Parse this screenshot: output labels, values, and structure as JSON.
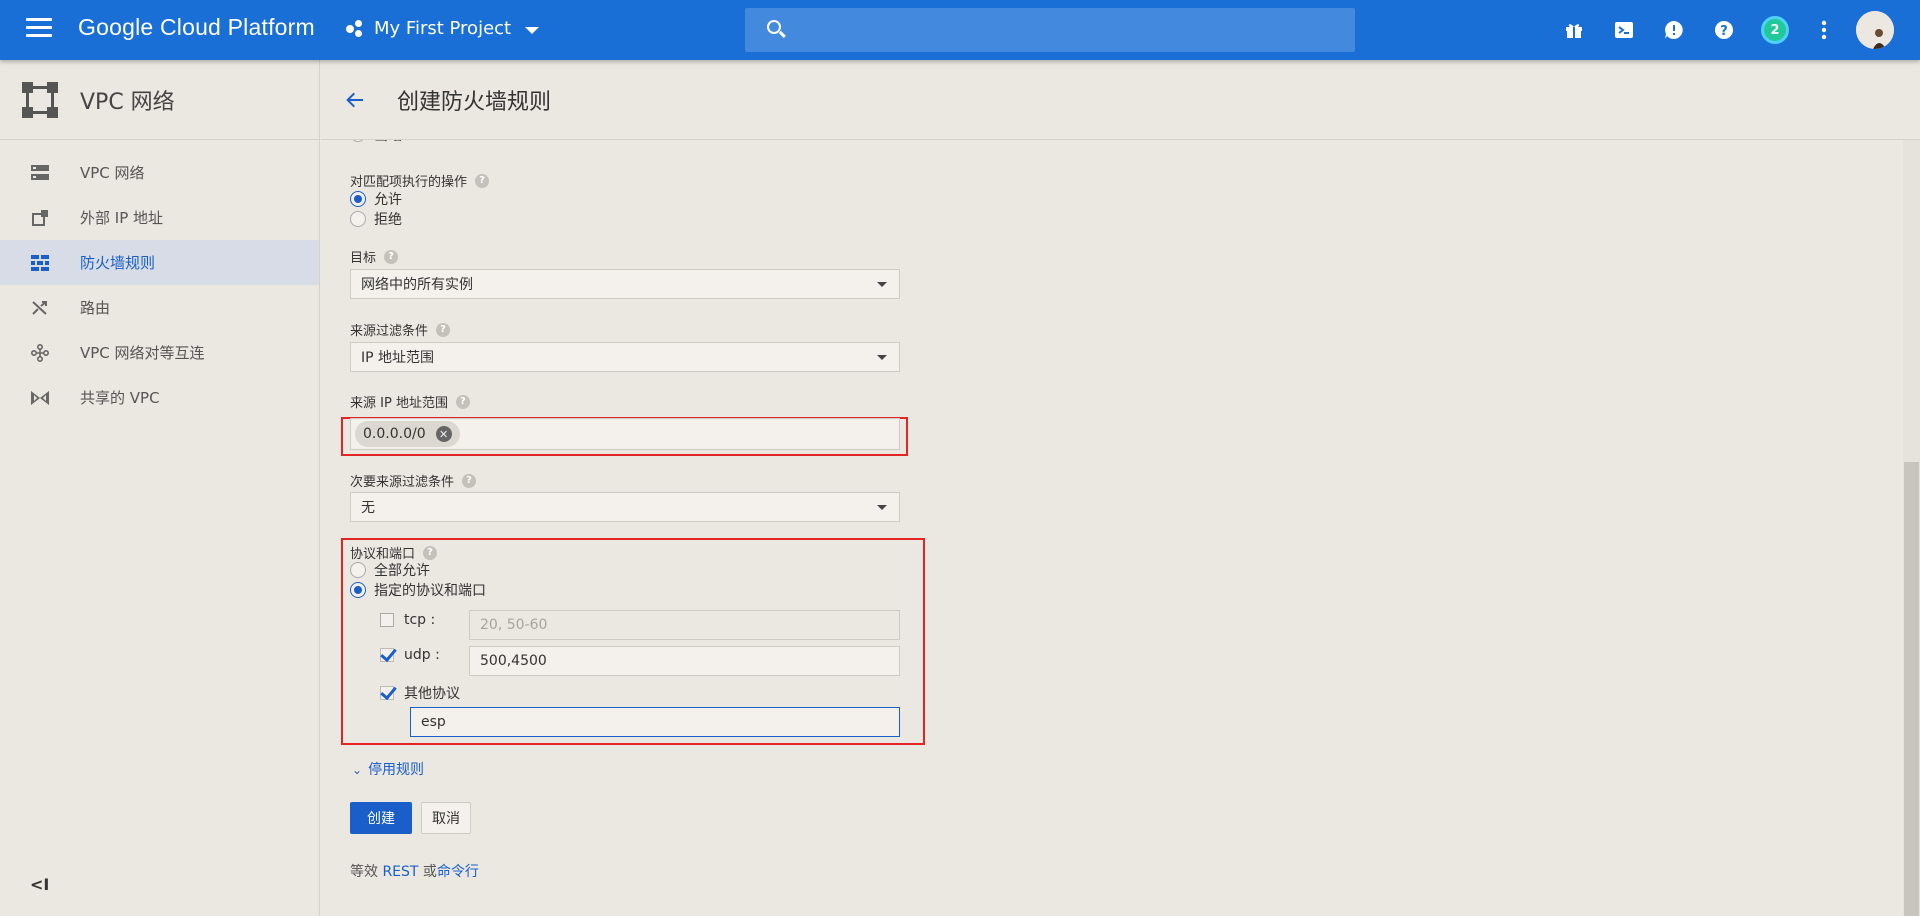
{
  "topbar": {
    "brand": "Google Cloud Platform",
    "project": "My First Project",
    "search_placeholder": "",
    "notification_count": "2",
    "icons": [
      "gift-icon",
      "cloud-shell-icon",
      "feedback-icon",
      "help-icon",
      "notifications-badge",
      "more-vert-icon",
      "account-avatar"
    ]
  },
  "sidebar": {
    "title": "VPC 网络",
    "items": [
      {
        "label": "VPC 网络",
        "icon": "vpc-networks-icon"
      },
      {
        "label": "外部 IP 地址",
        "icon": "external-ip-icon"
      },
      {
        "label": "防火墙规则",
        "icon": "firewall-icon",
        "active": true
      },
      {
        "label": "路由",
        "icon": "routes-icon"
      },
      {
        "label": "VPC 网络对等互连",
        "icon": "peering-icon"
      },
      {
        "label": "共享的 VPC",
        "icon": "shared-vpc-icon"
      }
    ],
    "collapse_label": "<I"
  },
  "page": {
    "title": "创建防火墙规则"
  },
  "form": {
    "direction_partial": "出站",
    "action_label": "对匹配项执行的操作",
    "action_options": [
      "允许",
      "拒绝"
    ],
    "action_selected": "允许",
    "target_label": "目标",
    "target_value": "网络中的所有实例",
    "source_filter_label": "来源过滤条件",
    "source_filter_value": "IP 地址范围",
    "source_ip_label": "来源 IP 地址范围",
    "source_ip_chip": "0.0.0.0/0",
    "secondary_filter_label": "次要来源过滤条件",
    "secondary_filter_value": "无",
    "protocols_label": "协议和端口",
    "protocol_all": "全部允许",
    "protocol_specified": "指定的协议和端口",
    "tcp_label": "tcp :",
    "tcp_placeholder": "20, 50-60",
    "udp_label": "udp :",
    "udp_value": "500,4500",
    "other_label": "其他协议",
    "other_value": "esp",
    "disable_rule_link": "停用规则",
    "create_button": "创建",
    "cancel_button": "取消",
    "equiv_prefix": "等效",
    "equiv_rest": "REST",
    "equiv_or": "或",
    "equiv_cli": "命令行"
  },
  "colors": {
    "topbar": "#1a6fd6",
    "accent": "#1a5fc9",
    "highlight_border": "#e32525"
  }
}
